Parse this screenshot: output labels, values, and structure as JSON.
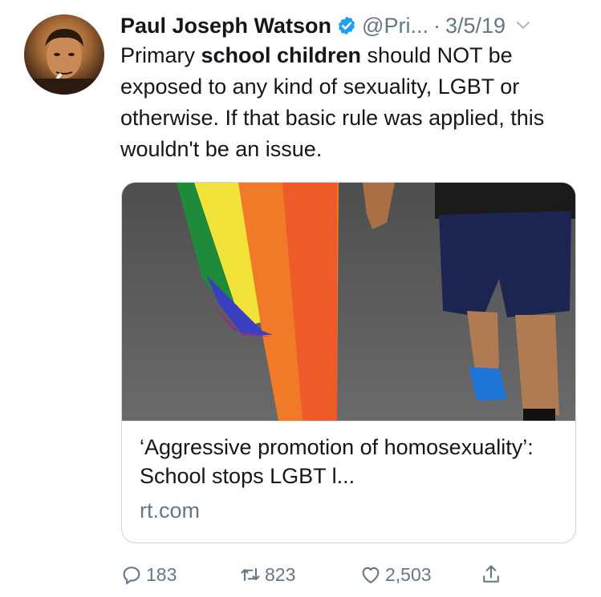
{
  "author": {
    "name": "Paul Joseph Watson",
    "handle": "@Pri...",
    "separator": "·",
    "date": "3/5/19",
    "verified_icon": "verified-badge-icon",
    "avatar_icon": "avatar"
  },
  "tweet": {
    "text_before": "Primary ",
    "text_bold": "school children",
    "text_after": " should NOT be exposed to any kind of sexuality, LGBT or otherwise. If that basic rule was applied, this wouldn't be an issue."
  },
  "card": {
    "title": "‘Aggressive promotion of homosexuality’: School stops LGBT l...",
    "domain": "rt.com"
  },
  "actions": {
    "replies": "183",
    "retweets": "823",
    "likes": "2,503"
  },
  "colors": {
    "accent": "#1da1f2",
    "muted": "#657786",
    "text": "#14171a",
    "border": "#ccd6dd"
  }
}
